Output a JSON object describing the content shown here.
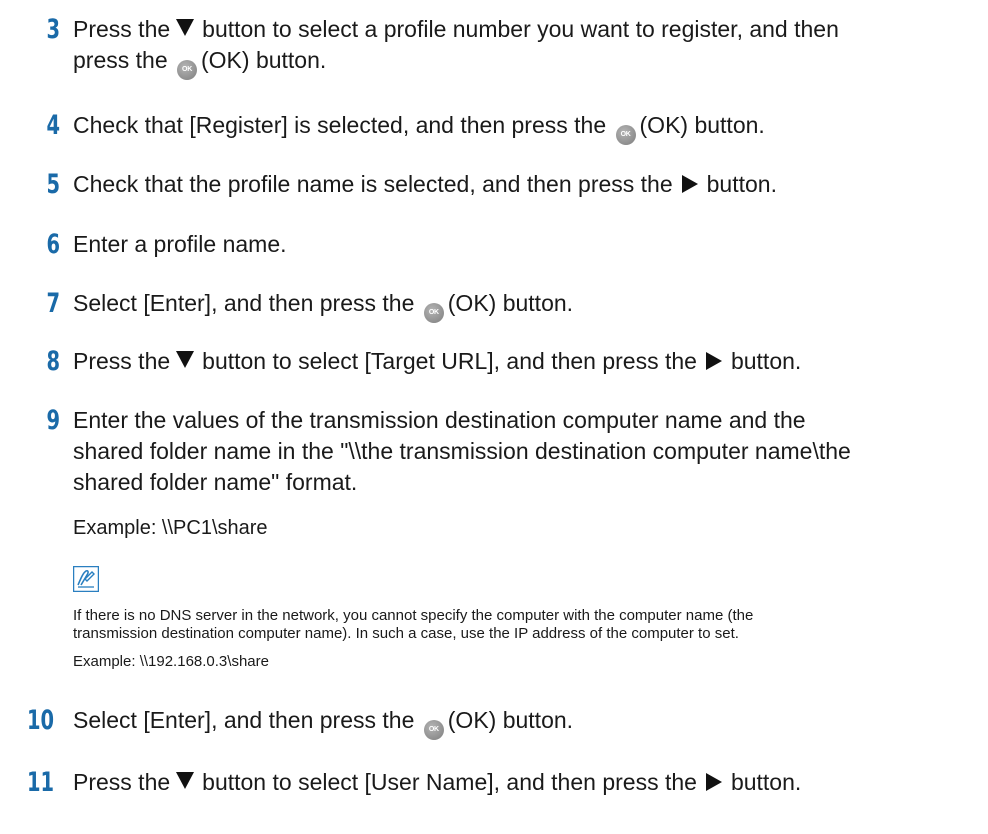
{
  "steps": [
    {
      "num": "3",
      "line1": "Press the",
      "line1b": "button to select a profile number you want to register, and then",
      "line2a": "press the",
      "line2b": "(OK) button."
    },
    {
      "num": "4",
      "a": "Check that [Register] is selected, and then press the",
      "b": "(OK) button."
    },
    {
      "num": "5",
      "a": "Check that the profile name is selected, and then press the",
      "b": "button."
    },
    {
      "num": "6",
      "a": "Enter a profile name."
    },
    {
      "num": "7",
      "a": "Select [Enter], and then press the",
      "b": "(OK) button."
    },
    {
      "num": "8",
      "a": "Press the",
      "b": "button to select [Target URL], and then press the",
      "c": "button."
    },
    {
      "num": "9",
      "line1": "Enter the values of the transmission destination computer name and the",
      "line2": "shared folder name in the \"\\\\the transmission destination computer name\\the",
      "line3": "shared folder name\" format.",
      "example": "Example: \\\\PC1\\share"
    },
    {
      "num": "10",
      "a": "Select [Enter], and then press the",
      "b": "(OK) button."
    },
    {
      "num": "11",
      "a": "Press the",
      "b": "button to select [User Name], and then press the",
      "c": "button."
    }
  ],
  "note": {
    "icon": "memo-pencil-icon",
    "line1": "If there is no DNS server in the network, you cannot specify the computer with the computer name (the",
    "line2": "transmission destination computer name). In such a case, use the IP address of the computer to set.",
    "example": "Example: \\\\192.168.0.3\\share"
  },
  "ok_icon_label": "OK",
  "colors": {
    "step_number": "#1a6aa8",
    "note_icon": "#2a7fc0"
  }
}
